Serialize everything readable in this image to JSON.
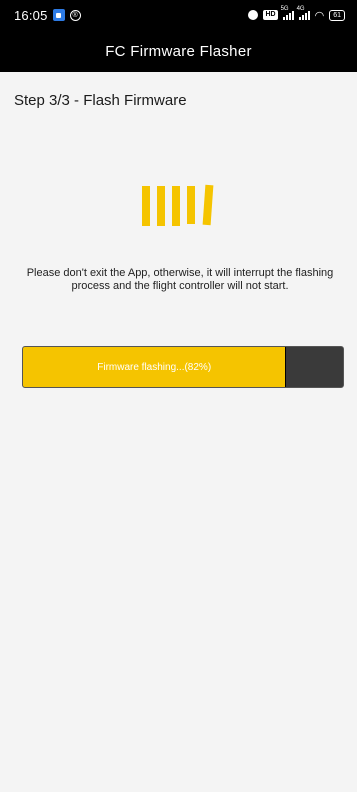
{
  "status_bar": {
    "time": "16:05",
    "network_5g": "5G",
    "network_4g": "4G",
    "battery": "61"
  },
  "header": {
    "title": "FC Firmware Flasher"
  },
  "step": {
    "label": "Step 3/3 - Flash Firmware"
  },
  "message": {
    "text": "Please don't exit the App, otherwise, it will interrupt the flashing process and the flight controller will not start."
  },
  "progress": {
    "label": "Firmware flashing...(82%)",
    "value": 0.82
  },
  "colors": {
    "accent": "#f5c400",
    "track": "#3a3a3a"
  }
}
